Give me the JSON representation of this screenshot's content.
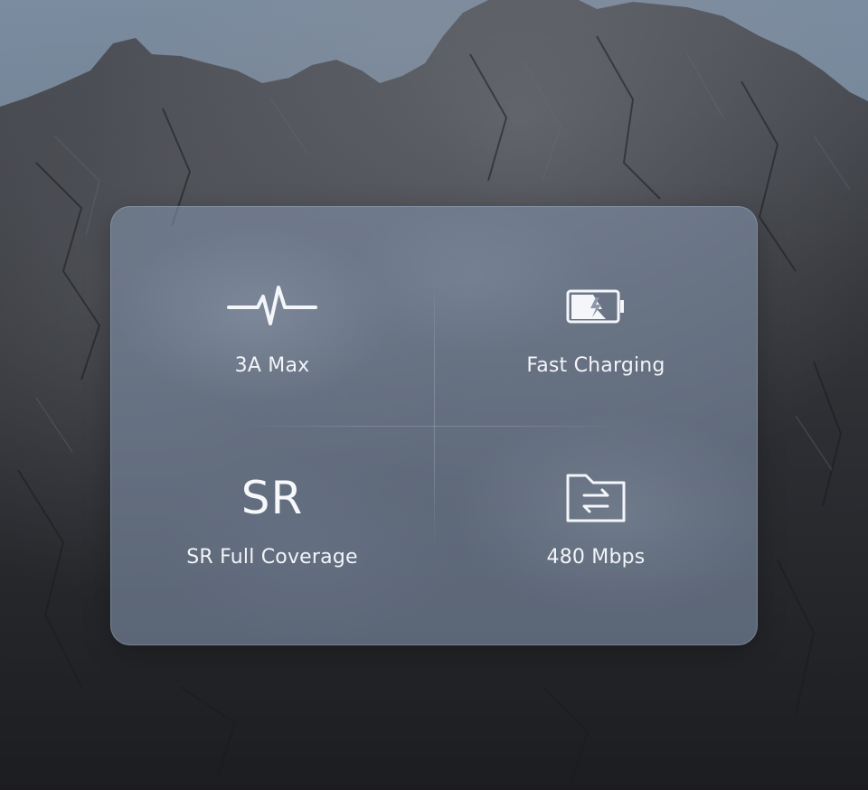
{
  "features": [
    {
      "label": "3A Max",
      "icon": "heartbeat-pulse-icon"
    },
    {
      "label": "Fast Charging",
      "icon": "battery-charging-icon"
    },
    {
      "label": "SR Full Coverage",
      "icon": "sr-text-icon",
      "icon_text": "SR"
    },
    {
      "label": "480 Mbps",
      "icon": "folder-transfer-icon"
    }
  ],
  "colors": {
    "panel": "#8090a8",
    "text": "#f2f4f8",
    "sky": "#6f8094",
    "rock": "#2a2c30"
  }
}
